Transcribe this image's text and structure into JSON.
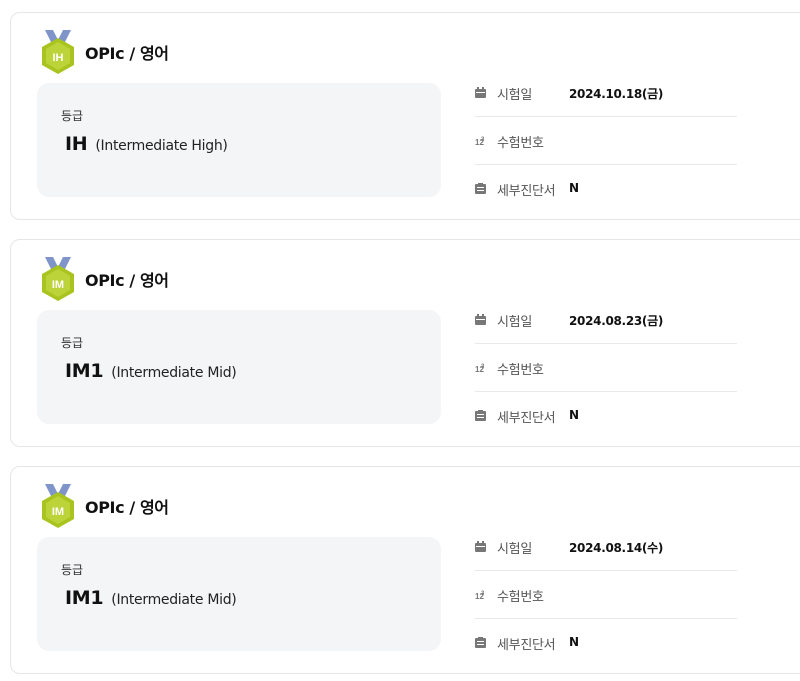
{
  "records": [
    {
      "badge": "IH",
      "title": "OPIc / 영어",
      "grade_label": "등급",
      "grade_code": "IH",
      "grade_desc": "(Intermediate High)",
      "exam_date_label": "시험일",
      "exam_date": "2024.10.18(금)",
      "exam_number_label": "수험번호",
      "exam_number": "",
      "diagnosis_label": "세부진단서",
      "diagnosis": "N"
    },
    {
      "badge": "IM",
      "title": "OPIc / 영어",
      "grade_label": "등급",
      "grade_code": "IM1",
      "grade_desc": "(Intermediate Mid)",
      "exam_date_label": "시험일",
      "exam_date": "2024.08.23(금)",
      "exam_number_label": "수험번호",
      "exam_number": "",
      "diagnosis_label": "세부진단서",
      "diagnosis": "N"
    },
    {
      "badge": "IM",
      "title": "OPIc / 영어",
      "grade_label": "등급",
      "grade_code": "IM1",
      "grade_desc": "(Intermediate Mid)",
      "exam_date_label": "시험일",
      "exam_date": "2024.08.14(수)",
      "exam_number_label": "수험번호",
      "exam_number": "",
      "diagnosis_label": "세부진단서",
      "diagnosis": "N"
    }
  ],
  "colors": {
    "medal_ribbon": "#7f95c9",
    "medal_body": "#a9c41f",
    "medal_inner": "#bdd33a",
    "card_border": "#e4e6ea",
    "grade_bg": "#f4f5f7"
  },
  "icons": {
    "exam_date": "calendar-icon",
    "exam_number": "number-icon",
    "diagnosis": "report-icon"
  }
}
